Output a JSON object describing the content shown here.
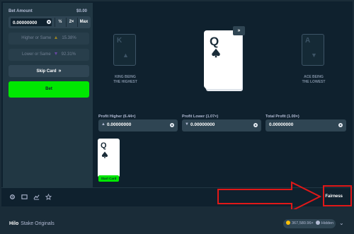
{
  "sidebar": {
    "bet_amount_label": "Bet Amount",
    "bet_amount_usd": "$0.00",
    "bet_value": "0.00000000",
    "half_label": "½",
    "double_label": "2×",
    "max_label": "Max",
    "higher_label": "Higher or Same",
    "higher_pct": "15.38%",
    "lower_label": "Lower or Same",
    "lower_pct": "92.31%",
    "skip_label": "Skip Card",
    "skip_chevron": "»",
    "bet_button_label": "Bet"
  },
  "stage": {
    "left_ghost_letter": "K",
    "left_caption_1": "KING BEING",
    "left_caption_2": "THE HIGHEST",
    "right_ghost_letter": "A",
    "right_caption_1": "ACE BEING",
    "right_caption_2": "THE LOWEST",
    "current_card_rank": "Q",
    "current_card_suit": "spade",
    "skip_chip_label": "»",
    "profit_higher_label": "Profit Higher (6.44×)",
    "profit_higher_value": "0.00000000",
    "profit_lower_label": "Profit Lower (1.07×)",
    "profit_lower_value": "0.00000000",
    "total_profit_label": "Total Profit (1.00×)",
    "total_profit_value": "0.00000000",
    "history_card_rank": "Q",
    "history_card_suit": "spade",
    "start_card_label": "Start Card"
  },
  "toolbar": {
    "icons": [
      "gear-icon",
      "tv-icon",
      "stats-icon",
      "star-icon"
    ],
    "fairness_label": "Fairness"
  },
  "footer": {
    "game_name": "Hilo",
    "provider": "Stake Originals",
    "balance": "367,580.96×",
    "visibility": "Hidden"
  },
  "colors": {
    "bg": "#1a2c38",
    "panel": "#213743",
    "input_bg": "#0f212e",
    "button": "#2f4553",
    "accent_green": "#00e701",
    "annotation_red": "#e01818"
  }
}
